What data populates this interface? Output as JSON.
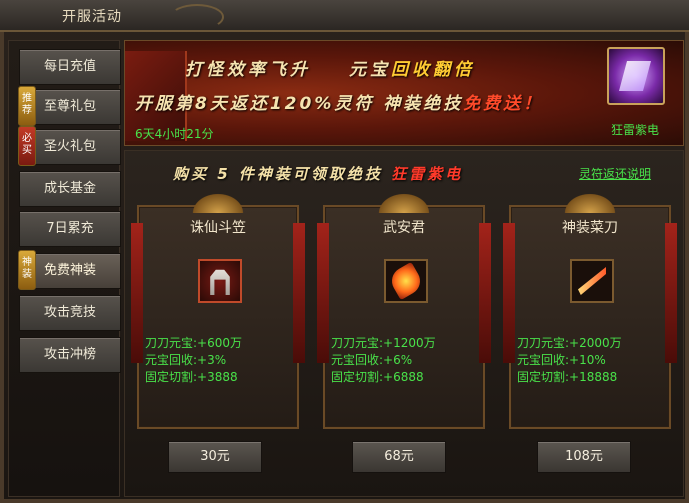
{
  "window": {
    "title": "开服活动"
  },
  "sidebar": {
    "items": [
      {
        "label": "每日充值",
        "badge": ""
      },
      {
        "label": "至尊礼包",
        "badge": "推荐"
      },
      {
        "label": "圣火礼包",
        "badge": "必买"
      },
      {
        "label": "成长基金",
        "badge": ""
      },
      {
        "label": "7日累充",
        "badge": ""
      },
      {
        "label": "免费神装",
        "badge": "神装",
        "active": true
      },
      {
        "label": "攻击竞技",
        "badge": ""
      },
      {
        "label": "攻击冲榜",
        "badge": ""
      }
    ]
  },
  "banner": {
    "line1": "打怪效率飞升",
    "line1b_prefix": "元宝",
    "line1b_hot": "回收翻倍",
    "line2_prefix": "开服第8天返还120%灵符  神装绝技",
    "line2_hot": "免费送！",
    "timer": "6天4小时21分",
    "skill_name": "狂雷紫电"
  },
  "main": {
    "headline_prefix": "购买 5 件神装可领取绝技",
    "headline_hot": "狂雷紫电",
    "help_link": "灵符返还说明",
    "cards": [
      {
        "name": "诛仙斗笠",
        "icon": "helmet-icon",
        "stat1": "刀刀元宝:+600万",
        "stat2": "元宝回收:+3%",
        "stat3": "固定切割:+3888",
        "price": "30元"
      },
      {
        "name": "武安君",
        "icon": "fire-blade-icon",
        "stat1": "刀刀元宝:+1200万",
        "stat2": "元宝回收:+6%",
        "stat3": "固定切割:+6888",
        "price": "68元"
      },
      {
        "name": "神装菜刀",
        "icon": "cleaver-icon",
        "stat1": "刀刀元宝:+2000万",
        "stat2": "元宝回收:+10%",
        "stat3": "固定切割:+18888",
        "price": "108元"
      }
    ]
  },
  "colors": {
    "stat_green": "#49e24a",
    "hot_red": "#ff3a2a",
    "text_cream": "#f6e3b0"
  }
}
